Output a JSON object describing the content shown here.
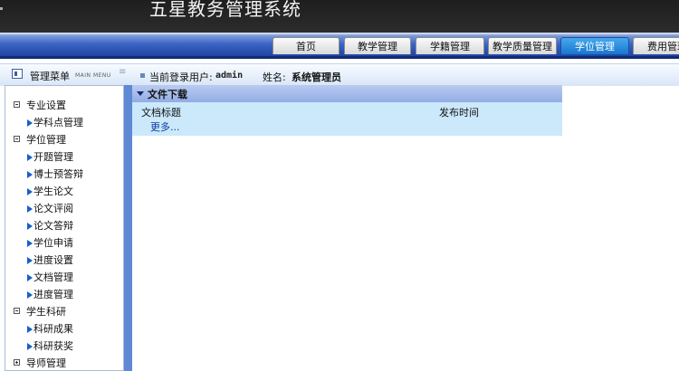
{
  "app": {
    "title": "五星教务管理系统"
  },
  "nav": {
    "tabs": [
      {
        "label": "首页",
        "active": false
      },
      {
        "label": "教学管理",
        "active": false
      },
      {
        "label": "学籍管理",
        "active": false
      },
      {
        "label": "教学质量管理",
        "active": false
      },
      {
        "label": "学位管理",
        "active": true
      },
      {
        "label": "费用管理",
        "active": false
      }
    ]
  },
  "header": {
    "menu_title": "管理菜单",
    "menu_subtitle": "MAIN MENU",
    "login_label": "当前登录用户:",
    "login_user": "admin",
    "name_label": "姓名:",
    "name_value": "系统管理员"
  },
  "sidebar": {
    "rows": [
      {
        "type": "group",
        "label": "专业设置",
        "expanded": true
      },
      {
        "type": "item",
        "label": "学科点管理"
      },
      {
        "type": "group",
        "label": "学位管理",
        "expanded": true
      },
      {
        "type": "item",
        "label": "开题管理"
      },
      {
        "type": "item",
        "label": "博士预答辩"
      },
      {
        "type": "item",
        "label": "学生论文"
      },
      {
        "type": "item",
        "label": "论文评阅"
      },
      {
        "type": "item",
        "label": "论文答辩"
      },
      {
        "type": "item",
        "label": "学位申请"
      },
      {
        "type": "item",
        "label": "进度设置"
      },
      {
        "type": "item",
        "label": "文档管理"
      },
      {
        "type": "item",
        "label": "进度管理"
      },
      {
        "type": "group",
        "label": "学生科研",
        "expanded": true
      },
      {
        "type": "item",
        "label": "科研成果"
      },
      {
        "type": "item",
        "label": "科研获奖"
      },
      {
        "type": "group",
        "label": "导师管理",
        "expanded": false
      }
    ]
  },
  "main": {
    "panel_title": "文件下载",
    "columns": {
      "doc_title": "文档标题",
      "publish_time": "发布时间"
    },
    "more_link": "更多..."
  },
  "colors": {
    "banner": "#242424",
    "nav_blue": "#1c3f9a",
    "active_tab": "#1877cf",
    "panel_header": "#a6bdec",
    "panel_body": "#cbe9fb",
    "sidebar_arrow": "#1560c9"
  }
}
